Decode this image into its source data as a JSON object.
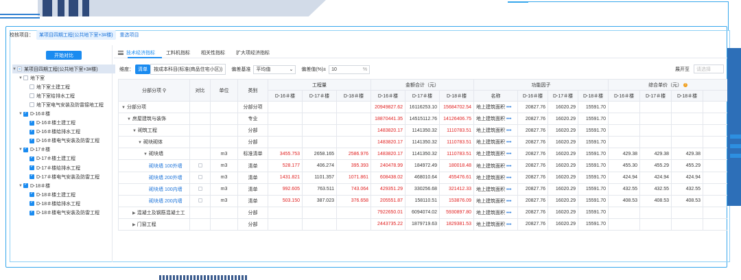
{
  "project": {
    "label": "校核项目：",
    "current": "某项目四期工程(公共地下室+3#楼)",
    "reselect": "重选项目"
  },
  "left": {
    "compare_button": "开始对比",
    "tree": [
      {
        "label": "某项目四期工程(公共地下室+3#楼)",
        "level": 0,
        "check": "half",
        "twisty": "▼",
        "selected": true
      },
      {
        "label": "地下室",
        "level": 1,
        "check": "off",
        "twisty": "▼"
      },
      {
        "label": "地下室土建工程",
        "level": 2,
        "check": "off",
        "twisty": ""
      },
      {
        "label": "地下室给排水工程",
        "level": 2,
        "check": "off",
        "twisty": ""
      },
      {
        "label": "地下室电气安装及防雷接地工程",
        "level": 2,
        "check": "off",
        "twisty": ""
      },
      {
        "label": "D-16＃楼",
        "level": 1,
        "check": "on",
        "twisty": "▼"
      },
      {
        "label": "D-16＃楼土建工程",
        "level": 2,
        "check": "on",
        "twisty": ""
      },
      {
        "label": "D-16＃楼给排水工程",
        "level": 2,
        "check": "on",
        "twisty": ""
      },
      {
        "label": "D-16＃楼电气安装及防雷工程",
        "level": 2,
        "check": "on",
        "twisty": ""
      },
      {
        "label": "D-17＃楼",
        "level": 1,
        "check": "on",
        "twisty": "▼"
      },
      {
        "label": "D-17＃楼土建工程",
        "level": 2,
        "check": "on",
        "twisty": ""
      },
      {
        "label": "D-17＃楼给排水工程",
        "level": 2,
        "check": "on",
        "twisty": ""
      },
      {
        "label": "D-17＃楼电气安装及防雷工程",
        "level": 2,
        "check": "on",
        "twisty": ""
      },
      {
        "label": "D-18＃楼",
        "level": 1,
        "check": "on",
        "twisty": "▼"
      },
      {
        "label": "D-18＃楼土建工程",
        "level": 2,
        "check": "on",
        "twisty": ""
      },
      {
        "label": "D-18＃楼给排水工程",
        "level": 2,
        "check": "on",
        "twisty": ""
      },
      {
        "label": "D-18＃楼电气安装及防雷工程",
        "level": 2,
        "check": "on",
        "twisty": ""
      }
    ]
  },
  "tabs": [
    "技术经济指标",
    "工料机指标",
    "相关性指标",
    "扩大项经济指标"
  ],
  "filters": {
    "dimension_label": "维度：",
    "dimension_active": "清单",
    "dimension_other": "按成本科目(标准(商品住宅小区))",
    "baseline_label": "偏差基准",
    "baseline_value": "平均值",
    "deviation_label": "偏差值(%)±",
    "deviation_value": "10",
    "deviation_unit": "%",
    "expand_label": "展开至",
    "expand_placeholder": "请选择"
  },
  "table": {
    "group_headers": {
      "name": "分部分项",
      "compare": "对比",
      "unit": "单位",
      "category": "类别",
      "quantity": "工程量",
      "amount": "金额合计（元）",
      "factor": "功能因子",
      "unit_price": "综合单价（元）"
    },
    "sub_headers": {
      "d16": "D-16＃楼",
      "d17": "D-17＃楼",
      "d18": "D-18＃楼",
      "factor_name": "名称"
    },
    "factor_name_value": "地上建筑面积",
    "rows": [
      {
        "name": "分部分项",
        "caret": "▼",
        "indent": 0,
        "link": false,
        "cb": false,
        "unit": "",
        "cat": "分部分项",
        "q16": "",
        "q17": "",
        "q18": "",
        "a16": "20949827.62",
        "a17": "16116253.10",
        "a18": "15684702.54",
        "f16": "20827.76",
        "f17": "16020.29",
        "f18": "15591.70",
        "p16": "",
        "p17": "",
        "p18": ""
      },
      {
        "name": "房屋建筑与装饰",
        "caret": "▼",
        "indent": 1,
        "link": false,
        "cb": false,
        "unit": "",
        "cat": "专业",
        "q16": "",
        "q17": "",
        "q18": "",
        "a16": "18870441.35",
        "a17": "14515112.76",
        "a18": "14126406.75",
        "f16": "20827.76",
        "f17": "16020.29",
        "f18": "15591.70",
        "p16": "",
        "p17": "",
        "p18": ""
      },
      {
        "name": "砌筑工程",
        "caret": "▼",
        "indent": 2,
        "link": false,
        "cb": false,
        "unit": "",
        "cat": "分部",
        "q16": "",
        "q17": "",
        "q18": "",
        "a16": "1483820.17",
        "a17": "1141350.32",
        "a18": "1110783.51",
        "f16": "20827.76",
        "f17": "16020.29",
        "f18": "15591.70",
        "p16": "",
        "p17": "",
        "p18": ""
      },
      {
        "name": "砌块砌体",
        "caret": "▼",
        "indent": 3,
        "link": false,
        "cb": false,
        "unit": "",
        "cat": "分部",
        "q16": "",
        "q17": "",
        "q18": "",
        "a16": "1483820.17",
        "a17": "1141350.32",
        "a18": "1110783.51",
        "f16": "20827.76",
        "f17": "16020.29",
        "f18": "15591.70",
        "p16": "",
        "p17": "",
        "p18": ""
      },
      {
        "name": "砌块墙",
        "caret": "▼",
        "indent": 4,
        "link": false,
        "cb": false,
        "unit": "m3",
        "cat": "标准清单",
        "q16": "3455.753",
        "q17": "2658.165",
        "q18": "2586.976",
        "a16": "1483820.17",
        "a17": "1141350.32",
        "a18": "1110783.51",
        "f16": "20827.76",
        "f17": "16020.29",
        "f18": "15591.70",
        "p16": "429.38",
        "p17": "429.38",
        "p18": "429.38"
      },
      {
        "name": "砌块墙 100外墙",
        "caret": "",
        "indent": 5,
        "link": true,
        "cb": true,
        "unit": "m3",
        "cat": "清单",
        "q16": "528.177",
        "q17": "406.274",
        "q18": "395.393",
        "a16": "240478.99",
        "a17": "184972.49",
        "a18": "180018.48",
        "f16": "20827.76",
        "f17": "16020.29",
        "f18": "15591.70",
        "p16": "455.30",
        "p17": "455.29",
        "p18": "455.29"
      },
      {
        "name": "砌块墙 200外墙",
        "caret": "",
        "indent": 5,
        "link": true,
        "cb": true,
        "unit": "m3",
        "cat": "清单",
        "q16": "1431.821",
        "q17": "1101.357",
        "q18": "1071.861",
        "a16": "608438.02",
        "a17": "468010.64",
        "a18": "455476.61",
        "f16": "20827.76",
        "f17": "16020.29",
        "f18": "15591.70",
        "p16": "424.94",
        "p17": "424.94",
        "p18": "424.94"
      },
      {
        "name": "砌块墙 100内墙",
        "caret": "",
        "indent": 5,
        "link": true,
        "cb": true,
        "unit": "m3",
        "cat": "清单",
        "q16": "992.605",
        "q17": "763.511",
        "q18": "743.064",
        "a16": "429351.29",
        "a17": "330256.68",
        "a18": "321412.33",
        "f16": "20827.76",
        "f17": "16020.29",
        "f18": "15591.70",
        "p16": "432.55",
        "p17": "432.55",
        "p18": "432.55"
      },
      {
        "name": "砌块墙 200内墙",
        "caret": "",
        "indent": 5,
        "link": true,
        "cb": true,
        "unit": "m3",
        "cat": "清单",
        "q16": "503.150",
        "q17": "387.023",
        "q18": "376.658",
        "a16": "205551.87",
        "a17": "158110.51",
        "a18": "153876.09",
        "f16": "20827.76",
        "f17": "16020.29",
        "f18": "15591.70",
        "p16": "408.53",
        "p17": "408.53",
        "p18": "408.53"
      },
      {
        "name": "混凝土及钢筋混凝土工",
        "caret": "▶",
        "indent": 2,
        "link": false,
        "cb": false,
        "unit": "",
        "cat": "分部",
        "q16": "",
        "q17": "",
        "q18": "",
        "a16": "7922650.01",
        "a17": "6094074.02",
        "a18": "5930897.80",
        "f16": "20827.76",
        "f17": "16020.29",
        "f18": "15591.70",
        "p16": "",
        "p17": "",
        "p18": ""
      },
      {
        "name": "门窗工程",
        "caret": "▶",
        "indent": 2,
        "link": false,
        "cb": false,
        "unit": "",
        "cat": "分部",
        "q16": "",
        "q17": "",
        "q18": "",
        "a16": "2443735.22",
        "a17": "1879719.63",
        "a18": "1829381.53",
        "f16": "20827.76",
        "f17": "16020.29",
        "f18": "15591.70",
        "p16": "",
        "p17": "",
        "p18": ""
      }
    ]
  }
}
